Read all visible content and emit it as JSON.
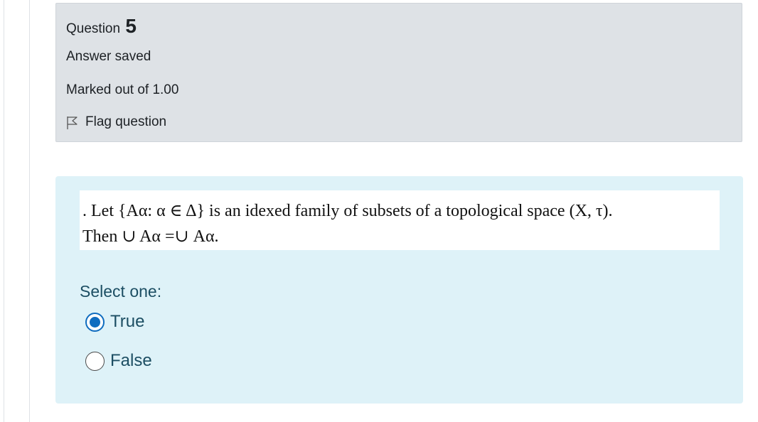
{
  "question_info": {
    "label": "Question",
    "number": "5",
    "state": "Answer saved",
    "grade": "Marked out of 1.00",
    "flag_label": "Flag question",
    "flag_icon": "flag-outline-icon"
  },
  "question_text": {
    "line1": ". Let {Aα: α ∈ Δ} is an idexed family of subsets of a topological space (X, τ).",
    "line2": "Then  ∪ Aα  =∪ Aα."
  },
  "answer": {
    "prompt": "Select one:",
    "options": [
      {
        "label": "True",
        "selected": true
      },
      {
        "label": "False",
        "selected": false
      }
    ]
  },
  "colors": {
    "info_bg": "#dee2e6",
    "content_bg": "#def2f8",
    "answer_text": "#1c4e63",
    "radio_accent": "#0f6cbf"
  }
}
